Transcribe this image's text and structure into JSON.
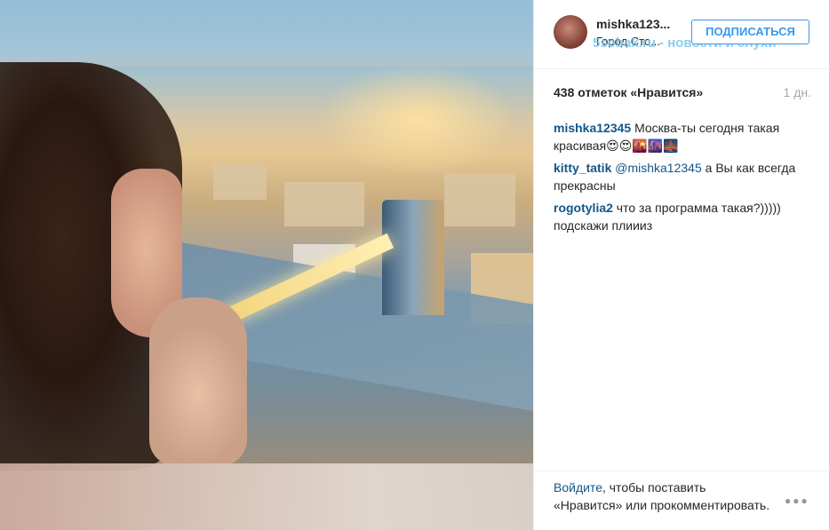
{
  "post": {
    "username": "mishka123...",
    "location": "Город Сто...",
    "follow_label": "ПОДПИСАТЬСЯ",
    "watermark": "5sobak.ru - новости и слухи",
    "likes": "438 отметок «Нравится»",
    "time": "1 дн."
  },
  "comments": [
    {
      "user": "mishka12345",
      "mention": "",
      "text": "Москва-ты сегодня такая красивая😍😍🌇🌆🌉"
    },
    {
      "user": "kitty_tatik",
      "mention": "@mishka12345",
      "text": " а Вы как всегда прекрасны"
    },
    {
      "user": "rogotylia2",
      "mention": "",
      "text": "что за программа такая?))))) подскажи плиииз"
    }
  ],
  "footer": {
    "login_link": "Войдите",
    "login_text": ", чтобы поставить «Нравится» или прокомментировать.",
    "more_icon": "ellipsis-icon",
    "more_glyph": "●●●"
  },
  "colors": {
    "accent": "#3897f0",
    "link": "#125688",
    "muted": "#a5a7aa"
  }
}
